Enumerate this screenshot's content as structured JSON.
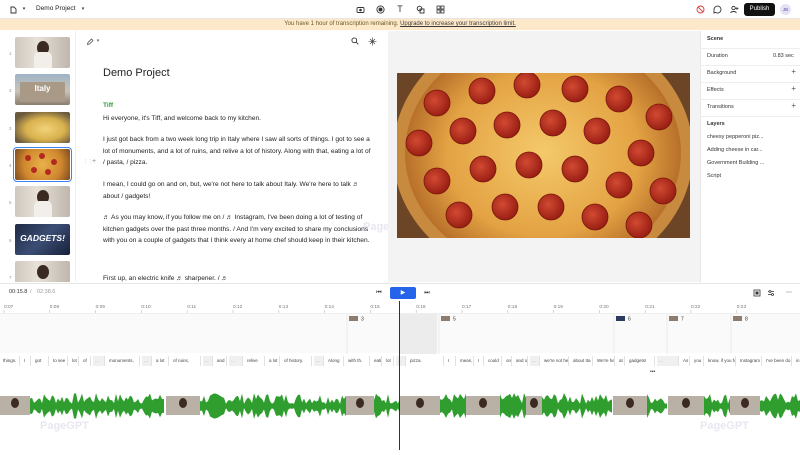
{
  "topbar": {
    "project_name": "Demo Project",
    "publish_label": "Publish",
    "avatar_initials": "JB"
  },
  "banner": {
    "text": "You have 1 hour of transcription remaining.",
    "link": "Upgrade to increase your transcription limit."
  },
  "thumbnails": [
    {
      "num": "1",
      "kind": "person"
    },
    {
      "num": "2",
      "kind": "italy",
      "caption": "Italy"
    },
    {
      "num": "3",
      "kind": "pasta"
    },
    {
      "num": "4",
      "kind": "pizza"
    },
    {
      "num": "5",
      "kind": "person"
    },
    {
      "num": "6",
      "kind": "gadgets",
      "caption": "GADGETS!"
    },
    {
      "num": "7",
      "kind": "person"
    }
  ],
  "script": {
    "title": "Demo Project",
    "speaker": "Tiff",
    "paragraphs": [
      "Hi everyone, it's Tiff, and welcome back to my kitchen.",
      "I just got back from a two week long trip in Italy where I saw all sorts of things. I got to see a lot of monuments, and a lot of ruins, and relive a lot of history. Along with that, eating a lot of / pasta, / pizza.",
      "I mean, I could go on and on, but, we're not here to talk about Italy. We're here to talk ♬ about / gadgets!",
      "♬ As you may know, if you follow me on / ♬ Instagram, I've been doing a lot of testing of kitchen gadgets over the past three months. / And I'm very excited to share my conclusions with you on a couple of gadgets that I think every at home chef should keep in their kitchen.",
      "First up, an electric knife ♬ sharpener. / ♬"
    ]
  },
  "right_panel": {
    "scene_label": "Scene",
    "duration_label": "Duration",
    "duration_value": "0.83 sec",
    "background_label": "Background",
    "effects_label": "Effects",
    "transitions_label": "Transitions",
    "layers_label": "Layers",
    "layers": [
      "cheesy pepperoni piz...",
      "Adding cheese in car...",
      "Government Building ...",
      "Script"
    ]
  },
  "player": {
    "current_time": "00:15.8",
    "total_time": "02:38.6"
  },
  "ruler_ticks": [
    "0:07",
    "0:08",
    "0:09",
    "0:10",
    "0:11",
    "0:12",
    "0:13",
    "0:14",
    "0:15",
    "0:16",
    "0:17",
    "0:18",
    "0:19",
    "0:20",
    "0:21",
    "0:22",
    "0:23"
  ],
  "scene_markers": [
    "3",
    "4",
    "5",
    "6",
    "7",
    "8"
  ],
  "words": [
    "things.",
    "I",
    "got",
    "to see",
    "lot",
    "of",
    "...",
    "monuments,",
    "...",
    "a lot",
    "of ruins,",
    "...",
    "and",
    "...",
    "relive",
    "a lot",
    "of history.",
    "...",
    "Along",
    "with th.",
    "eati",
    "lot",
    "...",
    "pizza.",
    "I",
    "mean,",
    "I",
    "could",
    "on",
    "and o",
    "...",
    "we're not he",
    "about Ita",
    "We're here",
    "at",
    "gadgets!",
    "...",
    "As",
    "you",
    "know, if you follo",
    "Instagram",
    "I've been do",
    "in"
  ],
  "colors": {
    "accent": "#2563eb",
    "speaker_green": "#2e9c3a",
    "waveform": "#2f9e2f",
    "banner_bg": "#fde9c9"
  },
  "watermark": "PageGPT"
}
